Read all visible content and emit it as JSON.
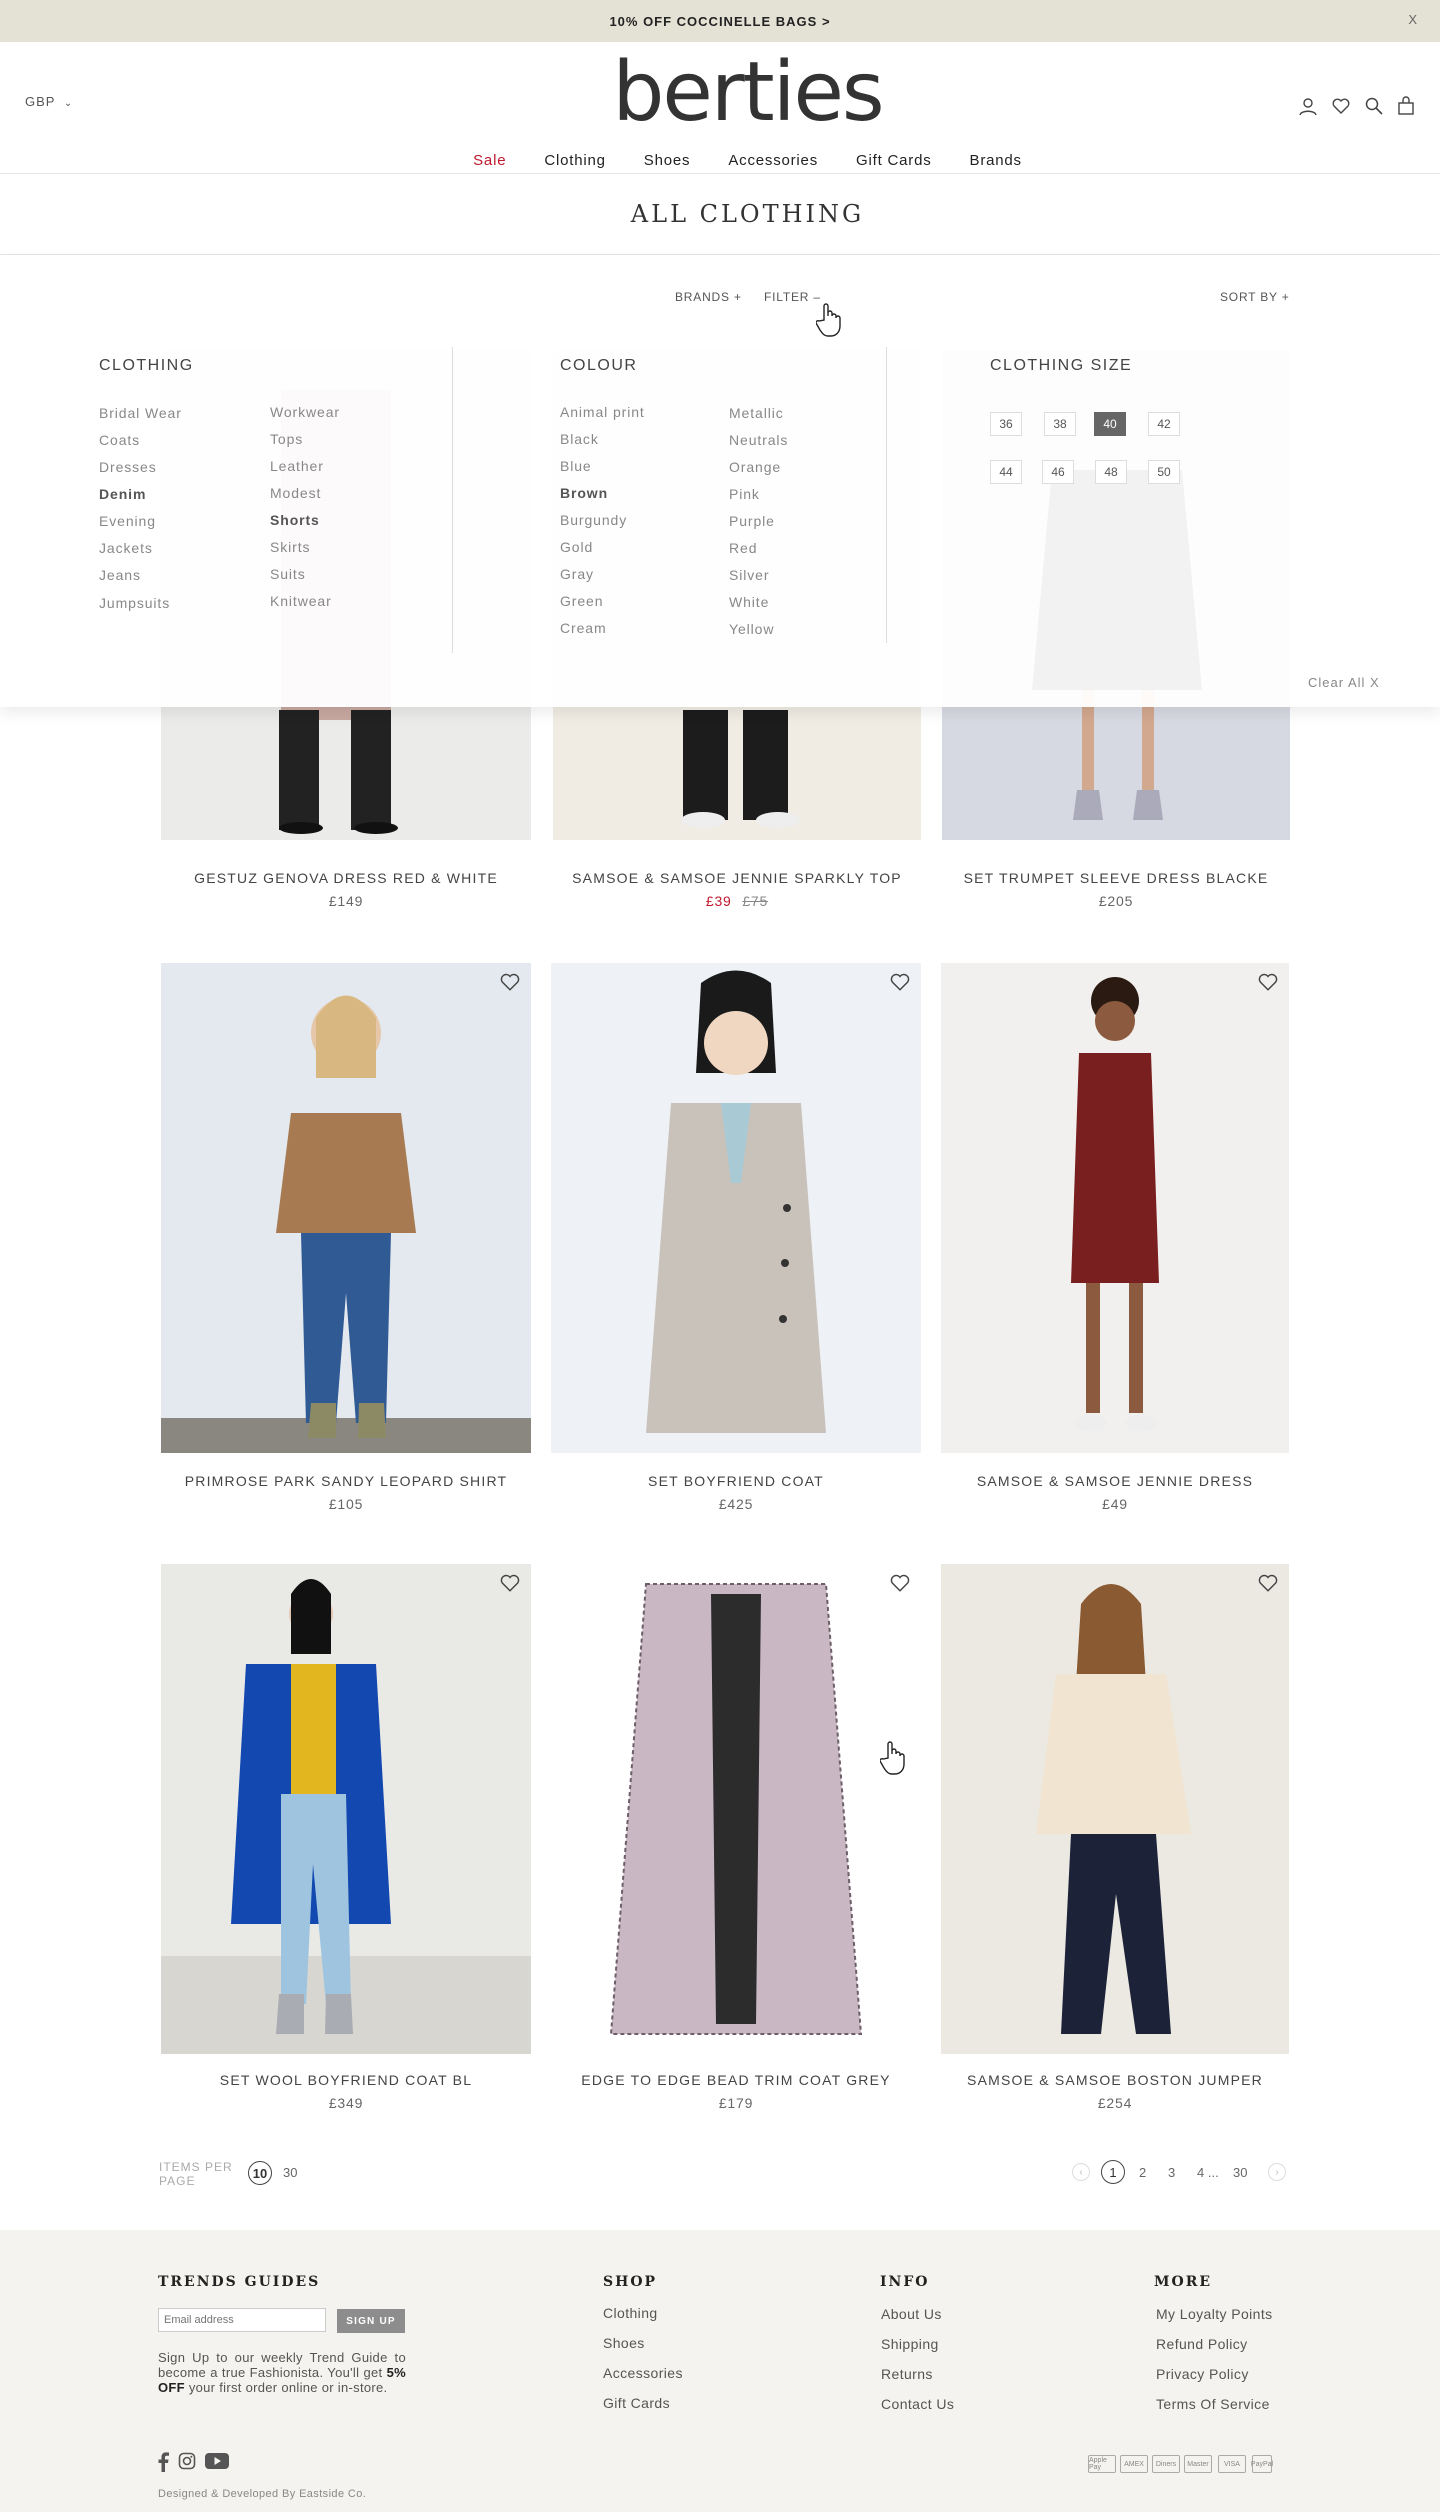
{
  "promo": {
    "text": "10% OFF COCCINELLE BAGS >",
    "close": "X"
  },
  "header": {
    "currency": "GBP",
    "logo": "berties"
  },
  "nav": {
    "items": [
      {
        "label": "Sale"
      },
      {
        "label": "Clothing"
      },
      {
        "label": "Shoes"
      },
      {
        "label": "Accessories"
      },
      {
        "label": "Gift Cards"
      },
      {
        "label": "Brands"
      }
    ]
  },
  "page": {
    "title": "ALL CLOTHING"
  },
  "filters": {
    "brands": "BRANDS +",
    "filter": "FILTER –",
    "sort": "SORT BY +"
  },
  "filter_panel": {
    "clothing": {
      "heading": "CLOTHING",
      "col1": [
        "Bridal Wear",
        "Coats",
        "Dresses",
        "Denim",
        "Evening",
        "Jackets",
        "Jeans",
        "Jumpsuits"
      ],
      "col2": [
        "Workwear",
        "Tops",
        "Leather",
        "Modest",
        "Shorts",
        "Skirts",
        "Suits",
        "Knitwear"
      ]
    },
    "colour": {
      "heading": "COLOUR",
      "col1": [
        "Animal print",
        "Black",
        "Blue",
        "Brown",
        "Burgundy",
        "Gold",
        "Gray",
        "Green",
        "Cream"
      ],
      "col2": [
        "Metallic",
        "Neutrals",
        "Orange",
        "Pink",
        "Purple",
        "Red",
        "Silver",
        "White",
        "Yellow"
      ]
    },
    "size": {
      "heading": "CLOTHING SIZE",
      "row1": [
        "36",
        "38",
        "40",
        "42"
      ],
      "row2": [
        "44",
        "46",
        "48",
        "50"
      ],
      "selected": "40"
    },
    "clear": "Clear All  X"
  },
  "products": [
    {
      "name": "GESTUZ GENOVA DRESS RED & WHITE",
      "price": "£149"
    },
    {
      "name": "SAMSOE & SAMSOE JENNIE SPARKLY TOP",
      "price": "£39",
      "old_price": "£75"
    },
    {
      "name": "SET TRUMPET SLEEVE DRESS BLACKE",
      "price": "£205"
    },
    {
      "name": "PRIMROSE PARK SANDY LEOPARD SHIRT",
      "price": "£105"
    },
    {
      "name": "SET BOYFRIEND COAT",
      "price": "£425"
    },
    {
      "name": "SAMSOE & SAMSOE JENNIE  DRESS",
      "price": "£49"
    },
    {
      "name": "SET WOOL BOYFRIEND COAT BL",
      "price": "£349"
    },
    {
      "name": "EDGE TO EDGE BEAD TRIM COAT GREY",
      "price": "£179"
    },
    {
      "name": "SAMSOE & SAMSOE BOSTON JUMPER",
      "price": "£254"
    }
  ],
  "pagination": {
    "items_per_page_label": "ITEMS PER PAGE",
    "per_page_options": [
      "10",
      "30"
    ],
    "current": "1",
    "pages": [
      "2",
      "3",
      "4 ...",
      "30"
    ]
  },
  "footer": {
    "trends": {
      "heading": "TRENDS GUIDES",
      "email_placeholder": "Email address",
      "signup": "SIGN UP",
      "blurb_1": "Sign Up to our weekly Trend Guide to become a true Fashionista. You'll get ",
      "blurb_bold": "5% OFF",
      "blurb_2": " your first order online or in-store."
    },
    "shop": {
      "heading": "SHOP",
      "links": [
        "Clothing",
        "Shoes",
        "Accessories",
        "Gift Cards"
      ]
    },
    "info": {
      "heading": "INFO",
      "links": [
        "About Us",
        "Shipping",
        "Returns",
        "Contact Us"
      ]
    },
    "more": {
      "heading": "MORE",
      "links": [
        "My Loyalty Points",
        "Refund Policy",
        "Privacy Policy",
        "Terms Of Service"
      ]
    },
    "credit": "Designed & Developed By Eastside Co.",
    "payments": [
      "Apple Pay",
      "AMEX",
      "Diners",
      "Master",
      "VISA",
      "PayPal"
    ]
  }
}
